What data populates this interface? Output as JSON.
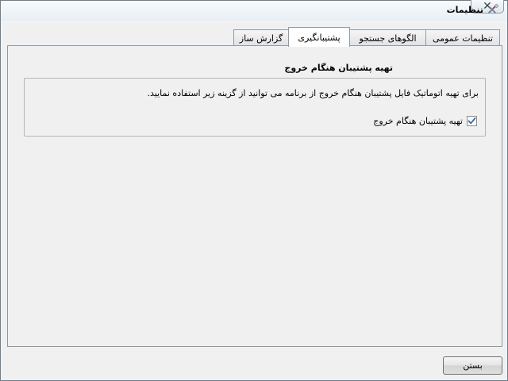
{
  "window": {
    "title": "تنظیمات",
    "close_glyph": "✕",
    "icon": "settings-tools-icon"
  },
  "tabs": [
    {
      "label": "تنظیمات عمومی",
      "active": false
    },
    {
      "label": "الگوهای جستجو",
      "active": false
    },
    {
      "label": "پشتیبانگیری",
      "active": true
    },
    {
      "label": "گزارش ساز",
      "active": false
    }
  ],
  "backup_panel": {
    "heading": "تهیه پشتیبان هنگام خروج",
    "description": "برای تهیه اتوماتیک فایل پشتیبان هنگام خروج از برنامه می توانید از گزینه زیر استفاده نمایید.",
    "checkbox": {
      "label": "تهیه پشتیبان هنگام خروج",
      "checked": true
    }
  },
  "footer": {
    "close_button_label": "بستن"
  },
  "colors": {
    "border": "#8c9aa8",
    "panel_bg": "#f0f0f0",
    "active_tab_bg": "#ffffff",
    "check_mark": "#3a6ea5"
  }
}
